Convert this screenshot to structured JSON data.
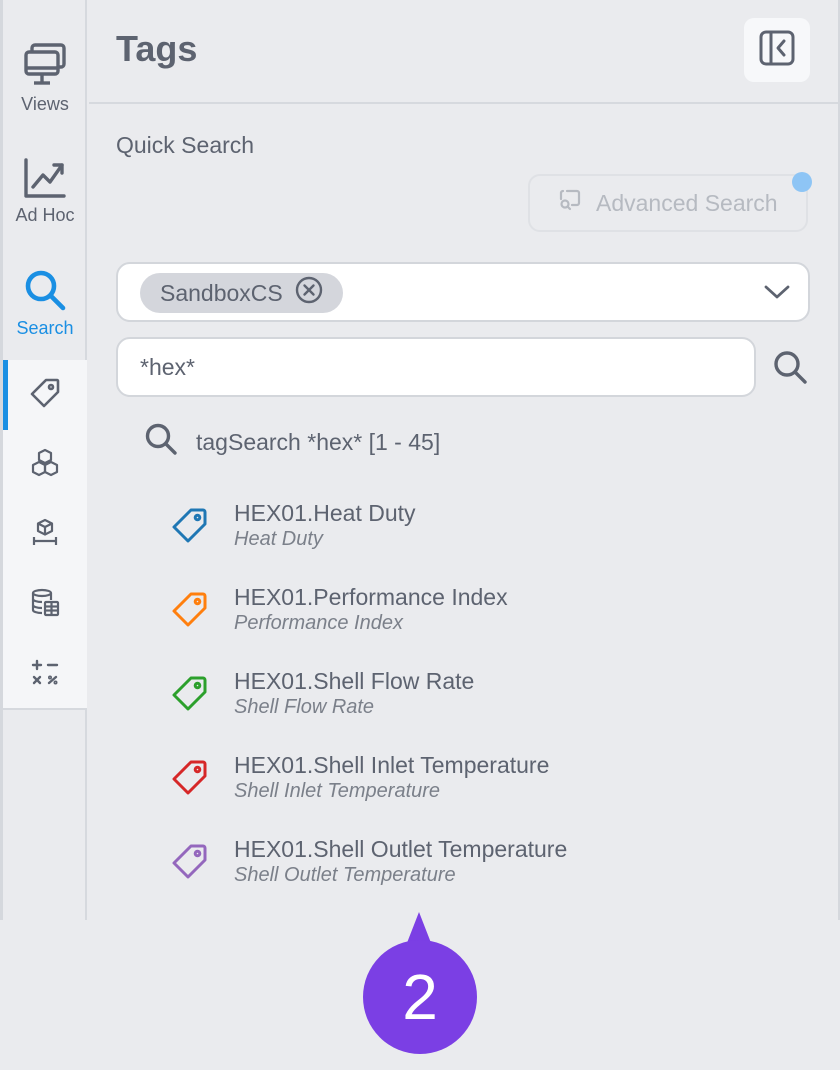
{
  "sidebar": {
    "nav": [
      {
        "label": "Views",
        "icon": "monitor-icon"
      },
      {
        "label": "Ad Hoc",
        "icon": "chart-line-icon"
      },
      {
        "label": "Search",
        "icon": "search-icon",
        "active": true
      }
    ],
    "subnav": [
      {
        "icon": "tag-icon",
        "active": true
      },
      {
        "icon": "cubes-icon"
      },
      {
        "icon": "asset-icon"
      },
      {
        "icon": "database-icon"
      },
      {
        "icon": "calculator-icon"
      }
    ]
  },
  "panel": {
    "title": "Tags",
    "collapse_icon": "collapse-panel-icon",
    "quick_search_label": "Quick Search",
    "advanced_search_label": "Advanced Search",
    "source_chip": "SandboxCS",
    "search_value": "*hex*",
    "result_summary": "tagSearch *hex* [1 - 45]"
  },
  "tags": [
    {
      "name": "HEX01.Heat Duty",
      "description": "Heat Duty",
      "color": "#1f77b4"
    },
    {
      "name": "HEX01.Performance Index",
      "description": "Performance Index",
      "color": "#ff7f0e"
    },
    {
      "name": "HEX01.Shell Flow Rate",
      "description": "Shell Flow Rate",
      "color": "#2ca02c"
    },
    {
      "name": "HEX01.Shell Inlet Temperature",
      "description": "Shell Inlet Temperature",
      "color": "#d62728"
    },
    {
      "name": "HEX01.Shell Outlet Temperature",
      "description": "Shell Outlet Temperature",
      "color": "#9467bd"
    }
  ],
  "step_badge": "2",
  "colors": {
    "accent": "#1a8fe3",
    "badge": "#7b3fe4"
  }
}
